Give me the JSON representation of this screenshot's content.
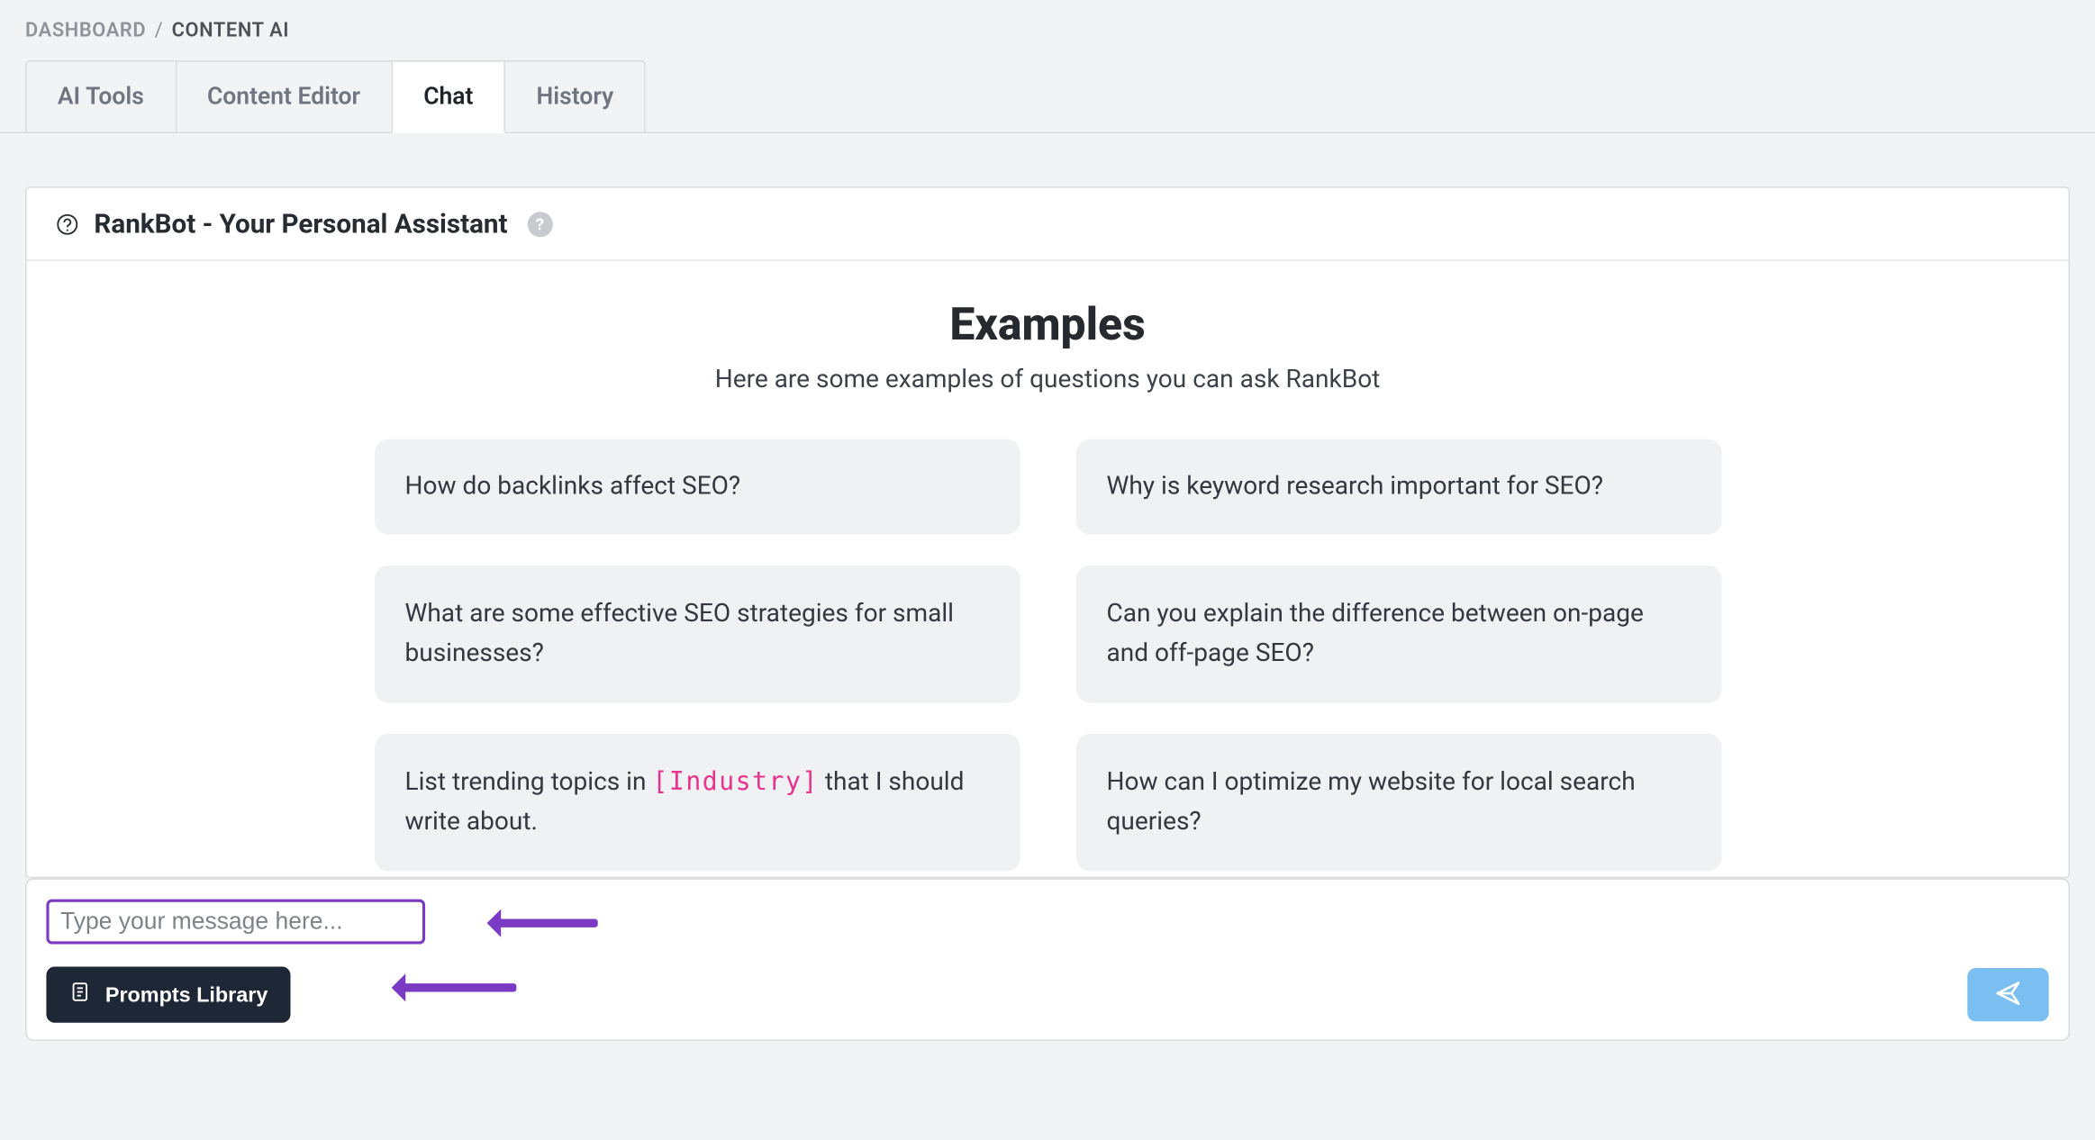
{
  "breadcrumb": {
    "root": "DASHBOARD",
    "current": "CONTENT AI"
  },
  "tabs": {
    "items": [
      {
        "label": "AI Tools",
        "active": false
      },
      {
        "label": "Content Editor",
        "active": false
      },
      {
        "label": "Chat",
        "active": true
      },
      {
        "label": "History",
        "active": false
      }
    ]
  },
  "panel": {
    "title": "RankBot - Your Personal Assistant"
  },
  "examples": {
    "heading": "Examples",
    "subheading": "Here are some examples of questions you can ask RankBot",
    "cards": [
      {
        "text": "How do backlinks affect SEO?"
      },
      {
        "text": "Why is keyword research important for SEO?"
      },
      {
        "text": "What are some effective SEO strategies for small businesses?"
      },
      {
        "text": "Can you explain the difference between on-page and off-page SEO?"
      },
      {
        "prefix": "List trending topics in ",
        "var": "[Industry]",
        "suffix": " that I should write about."
      },
      {
        "text": "How can I optimize my website for local search queries?"
      }
    ]
  },
  "composer": {
    "placeholder": "Type your message here...",
    "prompts_button": "Prompts Library"
  }
}
